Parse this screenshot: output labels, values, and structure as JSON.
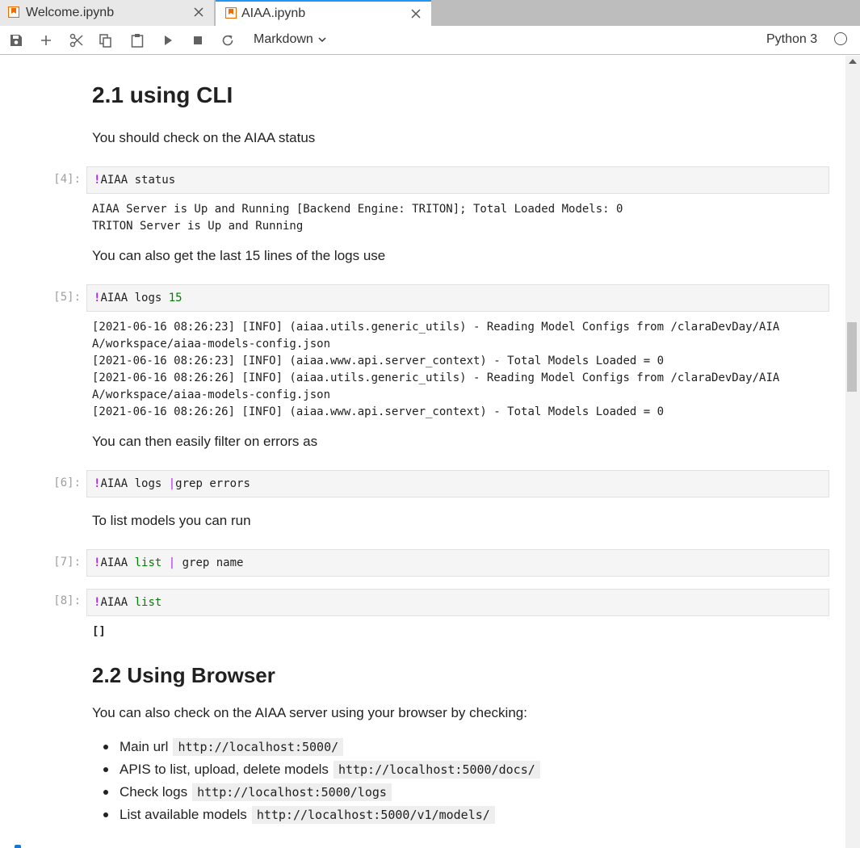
{
  "tabs": [
    {
      "label": "Welcome.ipynb"
    },
    {
      "label": "AIAA.ipynb"
    }
  ],
  "toolbar": {
    "cell_type": "Markdown",
    "kernel": "Python 3",
    "icons": [
      "save-icon",
      "add-icon",
      "cut-icon",
      "copy-icon",
      "paste-icon",
      "run-icon",
      "stop-icon",
      "restart-icon"
    ]
  },
  "notebook": {
    "h_cli": "2.1 using CLI",
    "p_status": "You should check on the AIAA status",
    "cell4": {
      "prompt": "[4]:",
      "bang": "!",
      "code": "AIAA status"
    },
    "out4": "AIAA Server is Up and Running [Backend Engine: TRITON]; Total Loaded Models: 0\nTRITON Server is Up and Running",
    "p_logs": "You can also get the last 15 lines of the logs use",
    "cell5": {
      "prompt": "[5]:",
      "bang": "!",
      "code": "AIAA logs ",
      "arg": "15"
    },
    "out5": "[2021-06-16 08:26:23] [INFO] (aiaa.utils.generic_utils) - Reading Model Configs from /claraDevDay/AIA\nA/workspace/aiaa-models-config.json\n[2021-06-16 08:26:23] [INFO] (aiaa.www.api.server_context) - Total Models Loaded = 0\n[2021-06-16 08:26:26] [INFO] (aiaa.utils.generic_utils) - Reading Model Configs from /claraDevDay/AIA\nA/workspace/aiaa-models-config.json\n[2021-06-16 08:26:26] [INFO] (aiaa.www.api.server_context) - Total Models Loaded = 0",
    "p_filter": "You can then easily filter on errors as",
    "cell6": {
      "prompt": "[6]:",
      "bang": "!",
      "code": "AIAA logs ",
      "pipe": "|",
      "rest": "grep errors"
    },
    "p_list": "To list models you can run",
    "cell7": {
      "prompt": "[7]:",
      "bang": "!",
      "code": "AIAA ",
      "kw": "list",
      "pipe": " | ",
      "rest": "grep name"
    },
    "cell8": {
      "prompt": "[8]:",
      "bang": "!",
      "code": "AIAA ",
      "kw": "list"
    },
    "out8": "[]",
    "h_browser": "2.2 Using Browser",
    "p_browser": "You can also check on the AIAA server using your browser by checking:",
    "bullets": [
      {
        "text": "Main url",
        "code": "http://localhost:5000/"
      },
      {
        "text": "APIS to list, upload, delete models",
        "code": "http://localhost:5000/docs/"
      },
      {
        "text": "Check logs",
        "code": "http://localhost:5000/logs"
      },
      {
        "text": "List available models",
        "code": "http://localhost:5000/v1/models/"
      }
    ]
  }
}
